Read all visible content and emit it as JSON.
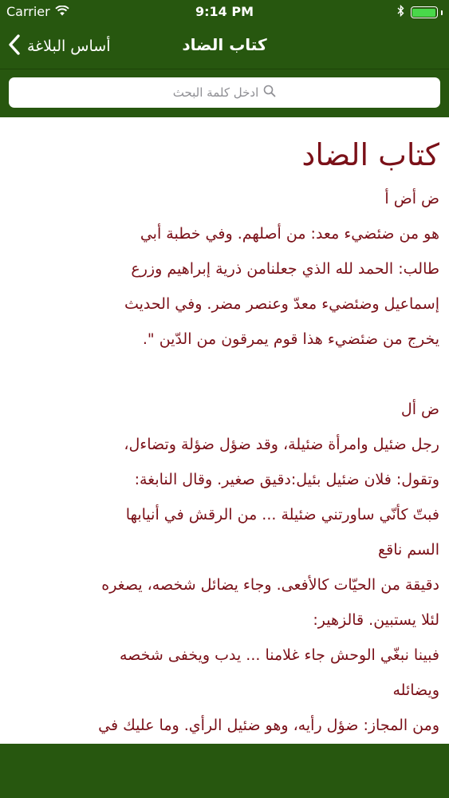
{
  "colors": {
    "bar_green": "#27570f",
    "text_maroon": "#7a1018",
    "battery_green": "#49d84a"
  },
  "status_bar": {
    "carrier": "Carrier",
    "time": "9:14 PM",
    "wifi_icon": "wifi-icon",
    "bluetooth_icon": "bluetooth-icon",
    "battery_percent": 100
  },
  "nav": {
    "back_label": "أساس البلاغة",
    "title": "كتاب الضاد",
    "back_icon": "chevron-left-icon"
  },
  "search": {
    "placeholder": "ادخل كلمة البحث",
    "icon": "search-icon"
  },
  "content": {
    "title": "كتاب الضاد",
    "section1": [
      "ض أض أ",
      "هو من ضئضيء معد: من أصلهم. وفي خطبة أبي",
      "طالب: الحمد لله الذي جعلنامن ذرية إبراهيم وزرع",
      "إسماعيل وضئضيء معدّ وعنصر مضر. وفي الحديث",
      "يخرج من ضئضيء هذا قوم يمرقون من الدّين \"."
    ],
    "section2": [
      "ض أل",
      "رجل ضئيل وامرأة ضئيلة، وقد ضؤل ضؤلة وتضاءل،",
      "وتقول: فلان ضئيل بئيل:دقيق صغير. وقال النابغة:",
      "فبتّ كأنّي ساورتني ضئيلة ... من الرقش في أنيابها",
      "السم ناقع",
      "دقيقة من الحيّات كالأفعى. وجاء يضائل شخصه، يصغره",
      "لئلا يستبين. قالزهير:",
      "فبينا نبغّي الوحش جاء غلامنا ... يدب ويخفى شخصه",
      "ويضائله",
      "ومن المجاز: ضؤل رأيه، وهو ضئيل الرأي. وما عليك في"
    ]
  }
}
